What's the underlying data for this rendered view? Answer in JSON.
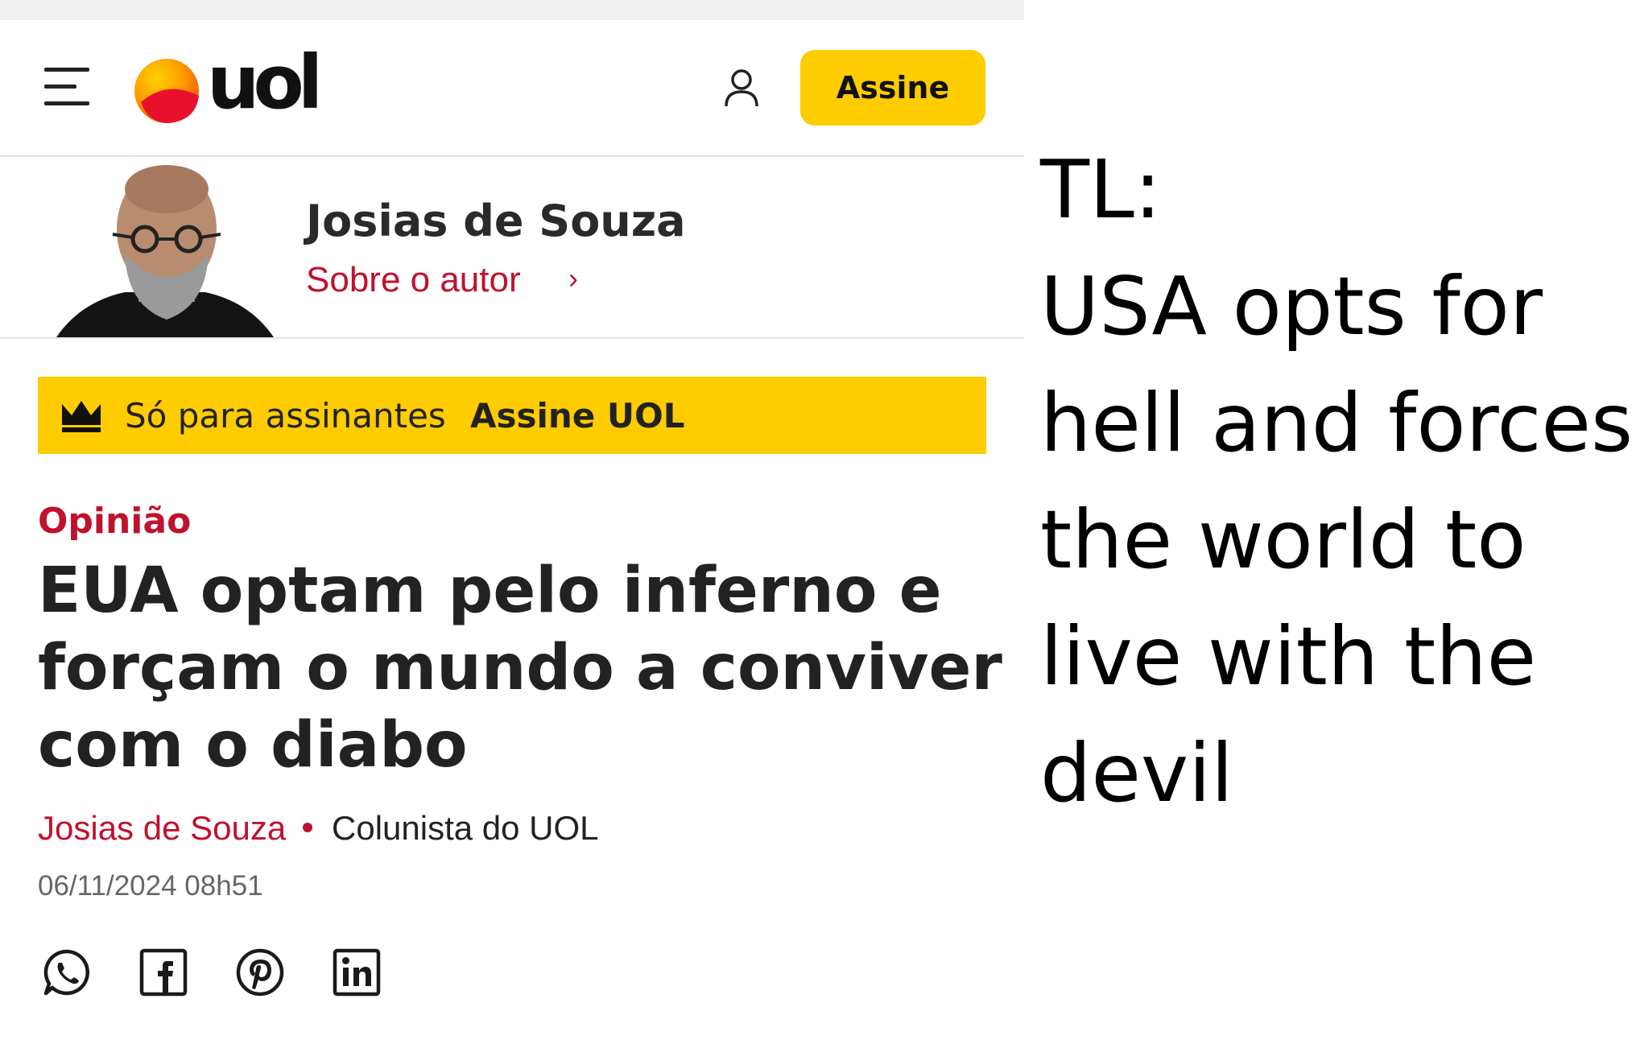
{
  "header": {
    "menu_icon": "hamburger-menu-icon",
    "logo_text": "uol",
    "user_icon": "user-icon",
    "subscribe_label": "Assine"
  },
  "author_card": {
    "name": "Josias de Souza",
    "about_label": "Sobre o autor",
    "chevron": "›"
  },
  "subscriber_banner": {
    "text": "Só para assinantes",
    "link_label": "Assine UOL",
    "icon": "crown-icon"
  },
  "article": {
    "section": "Opinião",
    "headline": "EUA optam pelo inferno e forçam o mundo a conviver com o diabo",
    "author": "Josias de Souza",
    "author_role": "Colunista do UOL",
    "date": "06/11/2024 08h51"
  },
  "share": [
    {
      "icon": "whatsapp-icon"
    },
    {
      "icon": "facebook-icon"
    },
    {
      "icon": "pinterest-icon"
    },
    {
      "icon": "linkedin-icon"
    }
  ],
  "caption": {
    "label": "TL:",
    "text": "USA opts for hell and forces the world to live with the devil"
  },
  "colors": {
    "accent_yellow": "#ffcc00",
    "brand_red": "#c0112d",
    "text_dark": "#222222"
  }
}
